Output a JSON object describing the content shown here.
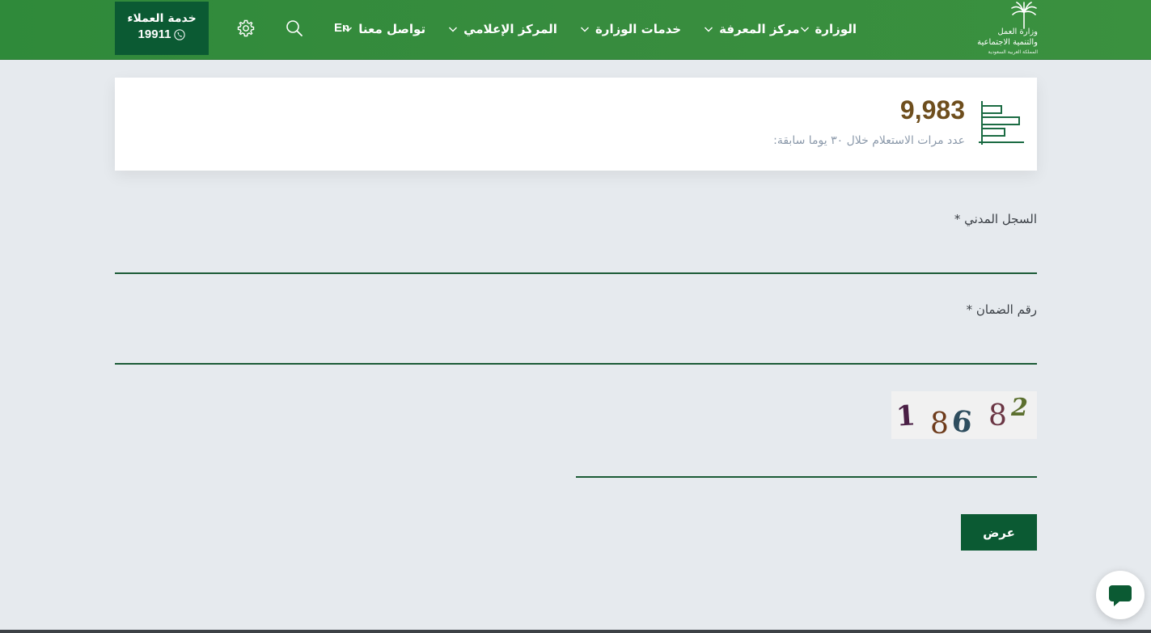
{
  "header": {
    "logo": {
      "line1": "وزارة العمل",
      "line2": "والتنمية الاجتماعية",
      "line3": "المملكة العربية السعودية"
    },
    "nav": [
      {
        "label": "الوزارة",
        "icon": "chevron-down-icon"
      },
      {
        "label": "مركز المعرفة",
        "icon": "chevron-down-icon"
      },
      {
        "label": "خدمات الوزارة",
        "icon": "chevron-down-icon"
      },
      {
        "label": "المركز الإعلامي",
        "icon": "chevron-down-icon"
      },
      {
        "label": "تواصل معنا",
        "icon": "chevron-down-icon"
      }
    ],
    "lang_label": "En",
    "search_icon": "search-icon",
    "settings_icon": "gear-icon",
    "customer_service": {
      "title": "خدمة العملاء",
      "number": "19911",
      "icon": "phone-icon"
    },
    "colors": {
      "header_bg": "#378c3e",
      "accent_dark": "#0b5a33"
    }
  },
  "stats": {
    "value": "9,983",
    "label": "عدد مرات الاستعلام خلال ٣٠ يوما سابقة:",
    "icon": "bar-chart-icon",
    "value_color": "#6e4e1d"
  },
  "form": {
    "civil_record_label": "السجل المدني *",
    "civil_record_value": "",
    "social_security_label": "رقم الضمان *",
    "social_security_value": "",
    "captcha": {
      "digits": [
        "1",
        "8",
        "6",
        "8",
        "2"
      ]
    },
    "captcha_value": "",
    "submit_label": "عرض"
  },
  "chat": {
    "icon": "chat-bubble-icon"
  }
}
